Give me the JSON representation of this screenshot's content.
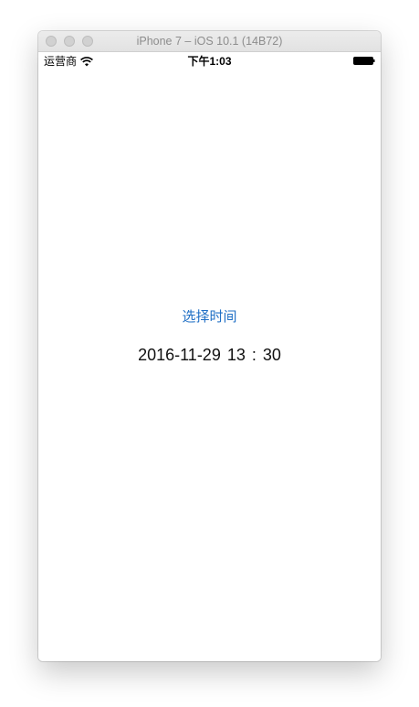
{
  "window": {
    "title": "iPhone 7 – iOS 10.1 (14B72)"
  },
  "status_bar": {
    "carrier": "运营商",
    "time": "下午1:03",
    "wifi_icon": "wifi-icon",
    "battery_icon": "battery-icon"
  },
  "main": {
    "pick_time_label": "选择时间",
    "selected_datetime": "2016-11-29  13 : 30"
  },
  "colors": {
    "accent": "#1f6fc5",
    "text": "#111111",
    "background": "#ffffff"
  }
}
